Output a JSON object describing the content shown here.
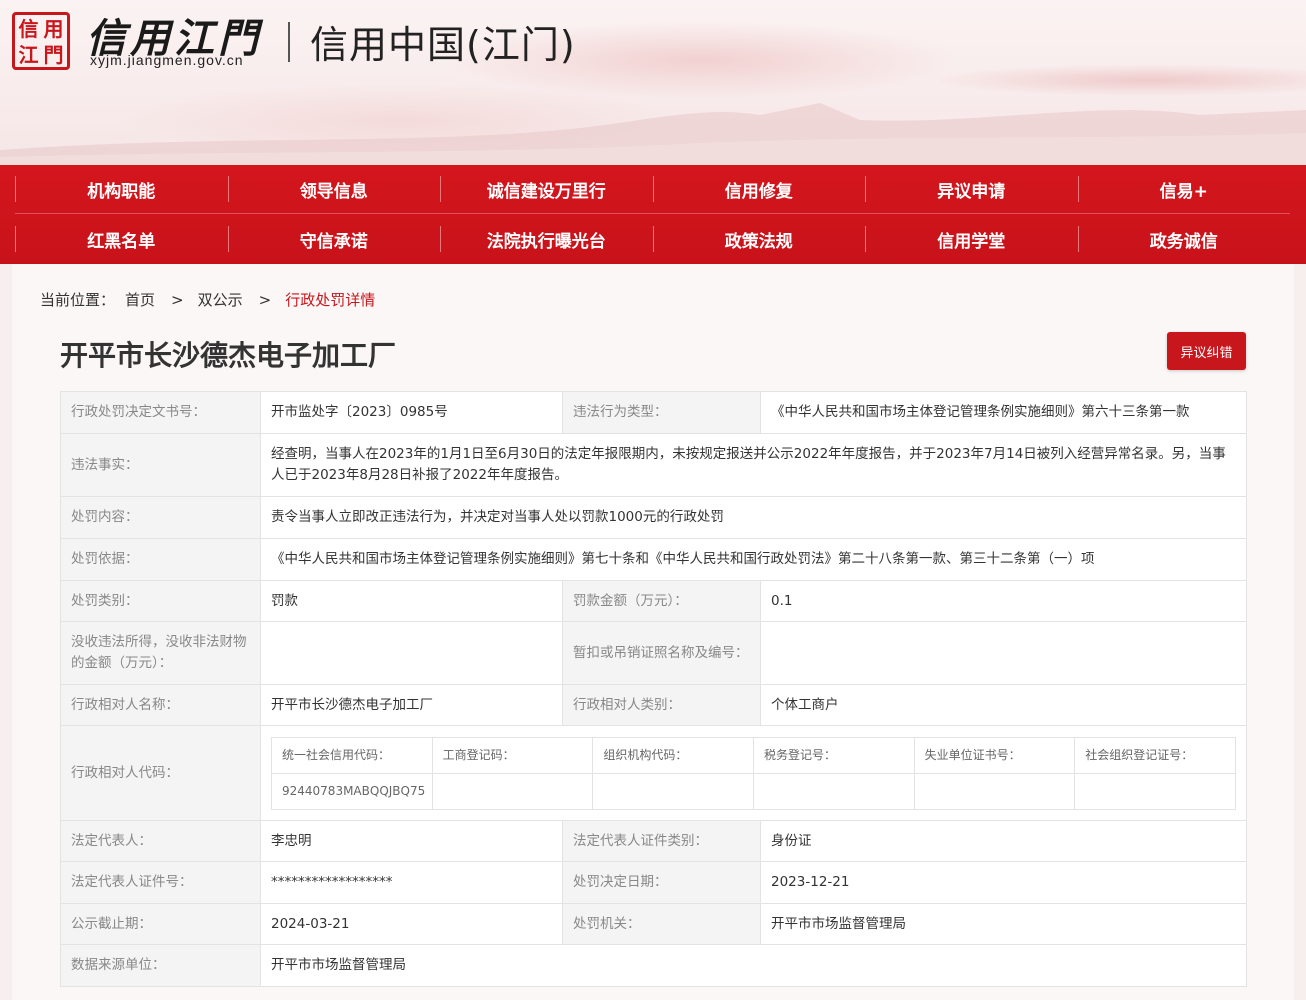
{
  "header": {
    "seal_chars": [
      "信",
      "用",
      "江",
      "門"
    ],
    "logo_text": "信用江門",
    "domain": "xyjm.jiangmen.gov.cn",
    "site_title": "信用中国(江门)",
    "brand_color": "#c8161d"
  },
  "nav": {
    "row1": [
      "机构职能",
      "领导信息",
      "诚信建设万里行",
      "信用修复",
      "异议申请",
      "信易+"
    ],
    "row2": [
      "红黑名单",
      "守信承诺",
      "法院执行曝光台",
      "政策法规",
      "信用学堂",
      "政务诚信"
    ]
  },
  "breadcrumb": {
    "label": "当前位置：",
    "home": "首页",
    "sep1": ">",
    "section": "双公示",
    "sep2": ">",
    "current": "行政处罚详情"
  },
  "page_title": "开平市长沙德杰电子加工厂",
  "objection_button": "异议纠错",
  "details": {
    "doc_no_label": "行政处罚决定文书号：",
    "doc_no": "开市监处字〔2023〕0985号",
    "violation_type_label": "违法行为类型：",
    "violation_type": "《中华人民共和国市场主体登记管理条例实施细则》第六十三条第一款",
    "facts_label": "违法事实：",
    "facts": "经查明，当事人在2023年的1月1日至6月30日的法定年报限期内，未按规定报送并公示2022年年度报告，并于2023年7月14日被列入经营异常名录。另，当事人已于2023年8月28日补报了2022年年度报告。",
    "content_label": "处罚内容：",
    "content": "责令当事人立即改正违法行为，并决定对当事人处以罚款1000元的行政处罚",
    "basis_label": "处罚依据：",
    "basis": "《中华人民共和国市场主体登记管理条例实施细则》第七十条和《中华人民共和国行政处罚法》第二十八条第一款、第三十二条第（一）项",
    "category_label": "处罚类别：",
    "category": "罚款",
    "fine_label": "罚款金额（万元）：",
    "fine": "0.1",
    "confiscation_label": "没收违法所得，没收非法财物的金额（万元）：",
    "confiscation": "",
    "license_label": "暂扣或吊销证照名称及编号：",
    "license": "",
    "party_name_label": "行政相对人名称：",
    "party_name": "开平市长沙德杰电子加工厂",
    "party_type_label": "行政相对人类别：",
    "party_type": "个体工商户",
    "party_code_label": "行政相对人代码：",
    "codes": {
      "headers": [
        "统一社会信用代码：",
        "工商登记码：",
        "组织机构代码：",
        "税务登记号：",
        "失业单位证书号：",
        "社会组织登记证号："
      ],
      "values": [
        "92440783MABQQJBQ75",
        "",
        "",
        "",
        "",
        ""
      ]
    },
    "legal_rep_label": "法定代表人：",
    "legal_rep": "李忠明",
    "legal_rep_id_type_label": "法定代表人证件类别：",
    "legal_rep_id_type": "身份证",
    "legal_rep_id_label": "法定代表人证件号：",
    "legal_rep_id": "******************",
    "decision_date_label": "处罚决定日期：",
    "decision_date": "2023-12-21",
    "publicity_end_label": "公示截止期：",
    "publicity_end": "2024-03-21",
    "authority_label": "处罚机关：",
    "authority": "开平市市场监督管理局",
    "source_label": "数据来源单位：",
    "source": "开平市市场监督管理局"
  }
}
